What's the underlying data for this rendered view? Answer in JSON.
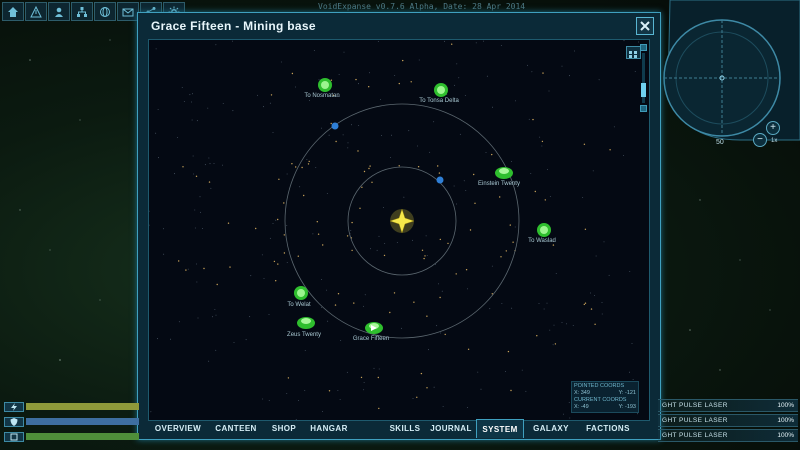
{
  "app": {
    "version_line": "VoidExpanse v0.7.6 Alpha, Date: 28 Apr 2014"
  },
  "toolbar": {
    "icons": [
      "home-icon",
      "warning-icon",
      "user-icon",
      "network-icon",
      "globe-icon",
      "mail-icon",
      "share-icon",
      "settings-icon"
    ]
  },
  "window": {
    "title": "Grace Fifteen - Mining base"
  },
  "map": {
    "nodes": [
      {
        "label": "To Nosmatan"
      },
      {
        "label": "To Tonsa Delta"
      },
      {
        "label": "Einstein Twenty"
      },
      {
        "label": "To Waslad"
      },
      {
        "label": "To Welat"
      },
      {
        "label": "Zeus Twenty"
      },
      {
        "label": "Grace Fifteen"
      }
    ],
    "coords": {
      "pointed_header": "POINTED COORDS",
      "pointed_x": "X: 349",
      "pointed_y": "Y: -121",
      "current_header": "CURRENT COORDS",
      "current_x": "X: -49",
      "current_y": "Y: -193"
    }
  },
  "tabs": [
    {
      "label": "OVERVIEW"
    },
    {
      "label": "CANTEEN"
    },
    {
      "label": "SHOP"
    },
    {
      "label": "HANGAR"
    },
    {
      "label": "SKILLS"
    },
    {
      "label": "JOURNAL"
    },
    {
      "label": "SYSTEM",
      "active": true
    },
    {
      "label": "GALAXY"
    },
    {
      "label": "FACTIONS"
    }
  ],
  "radar": {
    "range": "50",
    "zoom_level": "1x"
  },
  "status_bars": [
    {
      "name": "energy",
      "fill": 1.0,
      "color": "#8f9a3a"
    },
    {
      "name": "shield",
      "fill": 1.0,
      "color": "#3e6ea0"
    },
    {
      "name": "hull",
      "fill": 1.0,
      "color": "#4f8f3a"
    }
  ],
  "weapons": [
    {
      "name": "LIGHT PULSE LASER",
      "shown_name": "GHT PULSE LASER",
      "value": "100%"
    },
    {
      "name": "LIGHT PULSE LASER",
      "shown_name": "GHT PULSE LASER",
      "value": "100%"
    },
    {
      "name": "LIGHT PULSE LASER",
      "shown_name": "GHT PULSE LASER",
      "value": "100%"
    }
  ],
  "colors": {
    "accent": "#3fa0bf",
    "planet_green": "#3fd43a",
    "star": "#f0e040",
    "planet_blue": "#2f7fd6"
  }
}
